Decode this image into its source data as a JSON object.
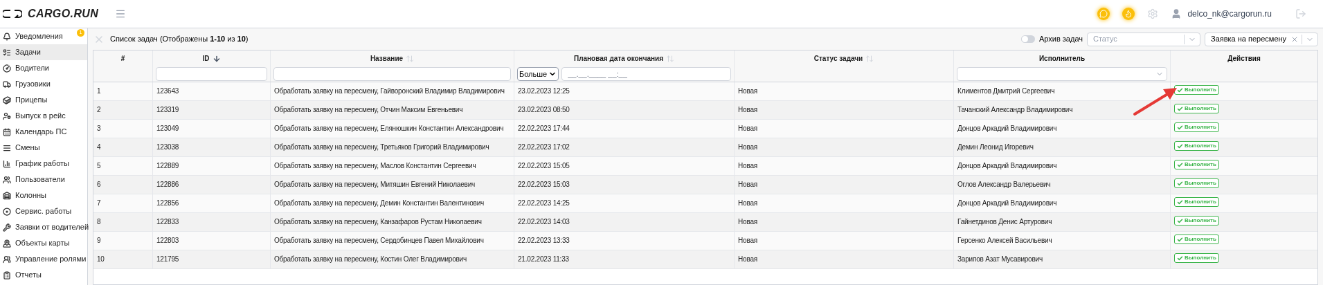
{
  "header": {
    "logo": "CARGO.RUN",
    "user": "delco_nk@cargorun.ru"
  },
  "sidebar": {
    "items": [
      {
        "label": "Уведомления",
        "selected": false,
        "badge": "1"
      },
      {
        "label": "Задачи",
        "selected": true
      },
      {
        "label": "Водители",
        "selected": false
      },
      {
        "label": "Грузовики",
        "selected": false
      },
      {
        "label": "Прицепы",
        "selected": false
      },
      {
        "label": "Выпуск в рейс",
        "selected": false
      },
      {
        "label": "Календарь ПС",
        "selected": false
      },
      {
        "label": "Смены",
        "selected": false
      },
      {
        "label": "График работы",
        "selected": false
      },
      {
        "label": "Пользователи",
        "selected": false
      },
      {
        "label": "Колонны",
        "selected": false
      },
      {
        "label": "Сервис. работы",
        "selected": false
      },
      {
        "label": "Заявки от водителей",
        "selected": false
      },
      {
        "label": "Объекты карты",
        "selected": false
      },
      {
        "label": "Управление ролями",
        "selected": false
      },
      {
        "label": "Отчеты",
        "selected": false
      }
    ]
  },
  "toolbar": {
    "title": "Список задач (Отображены **1-10** из **10**)",
    "archive_toggle": {
      "label": "Архив задач",
      "on": false
    },
    "status_select": {
      "placeholder": "Статус"
    },
    "type_select": {
      "value": "Заявка на пересмену"
    }
  },
  "table": {
    "columns": [
      {
        "label": "#",
        "kind": "plain",
        "sortable": false
      },
      {
        "label": "ID",
        "kind": "text",
        "sortable": true,
        "sorted": true
      },
      {
        "label": "Название",
        "kind": "text",
        "sortable": true,
        "sorted": false
      },
      {
        "label": "Плановая дата окончания",
        "kind": "date",
        "sortable": true,
        "sorted": false,
        "operator": "Больше",
        "placeholder": "__.__.____ __:__"
      },
      {
        "label": "Статус задачи",
        "kind": "plain",
        "sortable": true,
        "sorted": false
      },
      {
        "label": "Исполнитель",
        "kind": "select",
        "sortable": false
      },
      {
        "label": "Действия",
        "kind": "plain",
        "sortable": false
      }
    ],
    "rows": [
      {
        "num": "1",
        "id": "123643",
        "name": "Обработать заявку на пересмену, Гайворонский Владимир Владимирович",
        "date": "23.02.2023 12:25",
        "status": "Новая",
        "assignee": "Климентов Дмитрий Сергеевич",
        "action": "Выполнить"
      },
      {
        "num": "2",
        "id": "123319",
        "name": "Обработать заявку на пересмену, Отчин Максим Евгеньевич",
        "date": "23.02.2023 08:50",
        "status": "Новая",
        "assignee": "Тачанский Александр Владимирович",
        "action": "Выполнить"
      },
      {
        "num": "3",
        "id": "123049",
        "name": "Обработать заявку на пересмену, Елянюшкин Константин Александрович",
        "date": "22.02.2023 17:44",
        "status": "Новая",
        "assignee": "Донцов Аркадий Владимирович",
        "action": "Выполнить"
      },
      {
        "num": "4",
        "id": "123038",
        "name": "Обработать заявку на пересмену, Третьяков Григорий Владимирович",
        "date": "22.02.2023 17:02",
        "status": "Новая",
        "assignee": "Демин Леонид Игоревич",
        "action": "Выполнить"
      },
      {
        "num": "5",
        "id": "122889",
        "name": "Обработать заявку на пересмену, Маслов Константин Сергеевич",
        "date": "22.02.2023 15:05",
        "status": "Новая",
        "assignee": "Донцов Аркадий Владимирович",
        "action": "Выполнить"
      },
      {
        "num": "6",
        "id": "122886",
        "name": "Обработать заявку на пересмену, Митяшин Евгений Николаевич",
        "date": "22.02.2023 15:03",
        "status": "Новая",
        "assignee": "Оглов Александр Валерьевич",
        "action": "Выполнить"
      },
      {
        "num": "7",
        "id": "122856",
        "name": "Обработать заявку на пересмену, Демин Константин Валентинович",
        "date": "22.02.2023 14:25",
        "status": "Новая",
        "assignee": "Донцов Аркадий Владимирович",
        "action": "Выполнить"
      },
      {
        "num": "8",
        "id": "122833",
        "name": "Обработать заявку на пересмену, Канзафаров Рустам Николаевич",
        "date": "22.02.2023 14:03",
        "status": "Новая",
        "assignee": "Гайнетдинов Денис Артурович",
        "action": "Выполнить"
      },
      {
        "num": "9",
        "id": "122803",
        "name": "Обработать заявку на пересмену, Сердобинцев Павел Михайлович",
        "date": "22.02.2023 13:33",
        "status": "Новая",
        "assignee": "Герсенко Алексей Васильевич",
        "action": "Выполнить"
      },
      {
        "num": "10",
        "id": "121795",
        "name": "Обработать заявку на пересмену, Костин Олег Владимирович",
        "date": "21.02.2023 11:33",
        "status": "Новая",
        "assignee": "Зарипов Азат Мусавирович",
        "action": "Выполнить"
      }
    ]
  }
}
